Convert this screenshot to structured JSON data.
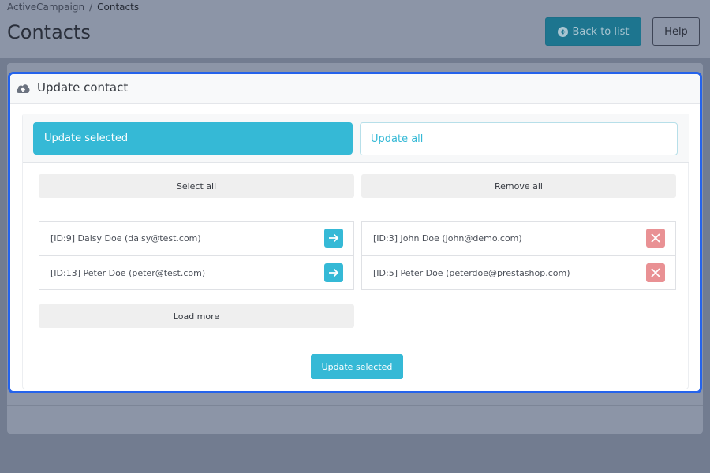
{
  "breadcrumb": {
    "parent": "ActiveCampaign",
    "separator": "/",
    "current": "Contacts"
  },
  "page": {
    "title": "Contacts"
  },
  "toolbar": {
    "back_label": "Back to list",
    "help_label": "Help"
  },
  "modal": {
    "icon": "cloud-upload-icon",
    "title": "Update contact",
    "tabs": [
      {
        "label": "Update selected",
        "active": true
      },
      {
        "label": "Update all",
        "active": false
      }
    ],
    "select_all_label": "Select all",
    "remove_all_label": "Remove all",
    "available": [
      {
        "label": "[ID:9] Daisy Doe (daisy@test.com)",
        "icon": "arrow-right-icon"
      },
      {
        "label": "[ID:13] Peter Doe (peter@test.com)",
        "icon": "arrow-right-icon"
      }
    ],
    "selected": [
      {
        "label": "[ID:3] John Doe (john@demo.com)",
        "icon": "close-icon"
      },
      {
        "label": "[ID:5] Peter Doe (peterdoe@prestashop.com)",
        "icon": "close-icon"
      }
    ],
    "load_more_label": "Load more",
    "submit_label": "Update selected"
  },
  "colors": {
    "accent": "#35b9d6",
    "remove": "#e99194",
    "focus_border": "#2563eb",
    "overlay": "#727c90"
  }
}
